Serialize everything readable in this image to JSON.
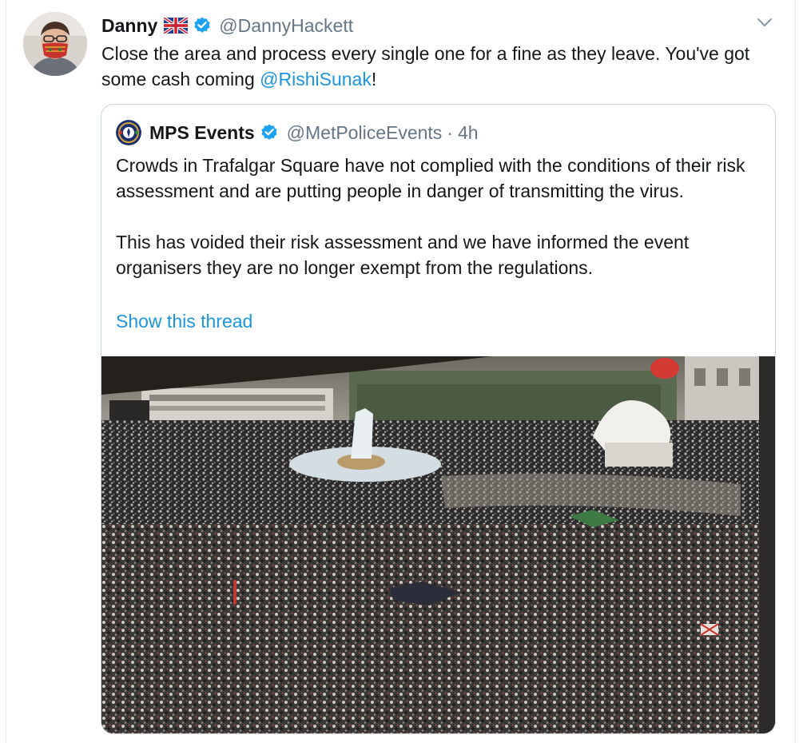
{
  "tweet": {
    "author_name": "Danny",
    "author_handle": "@DannyHackett",
    "text_before": "Close the area and process every single one for a fine as they leave. You've got some cash coming ",
    "mention": "@RishiSunak",
    "text_after": "!"
  },
  "quoted_tweet": {
    "author_name": "MPS Events",
    "author_handle": "@MetPoliceEvents",
    "separator": "·",
    "time": "4h",
    "paragraph_1": "Crowds in Trafalgar Square have not complied with the conditions of their risk assessment and are putting people in danger of transmitting the virus.",
    "paragraph_2": "This has voided their risk assessment and we have informed the event organisers they are no longer exempt from the regulations.",
    "show_thread": "Show this thread"
  },
  "colors": {
    "link": "#1b95e0",
    "verified": "#1da1f2",
    "secondary_text": "#657786",
    "border": "#ccd6dd"
  },
  "icons": {
    "flag": "union-jack-flag-icon",
    "verified": "verified-badge-icon",
    "menu": "chevron-down-icon"
  }
}
